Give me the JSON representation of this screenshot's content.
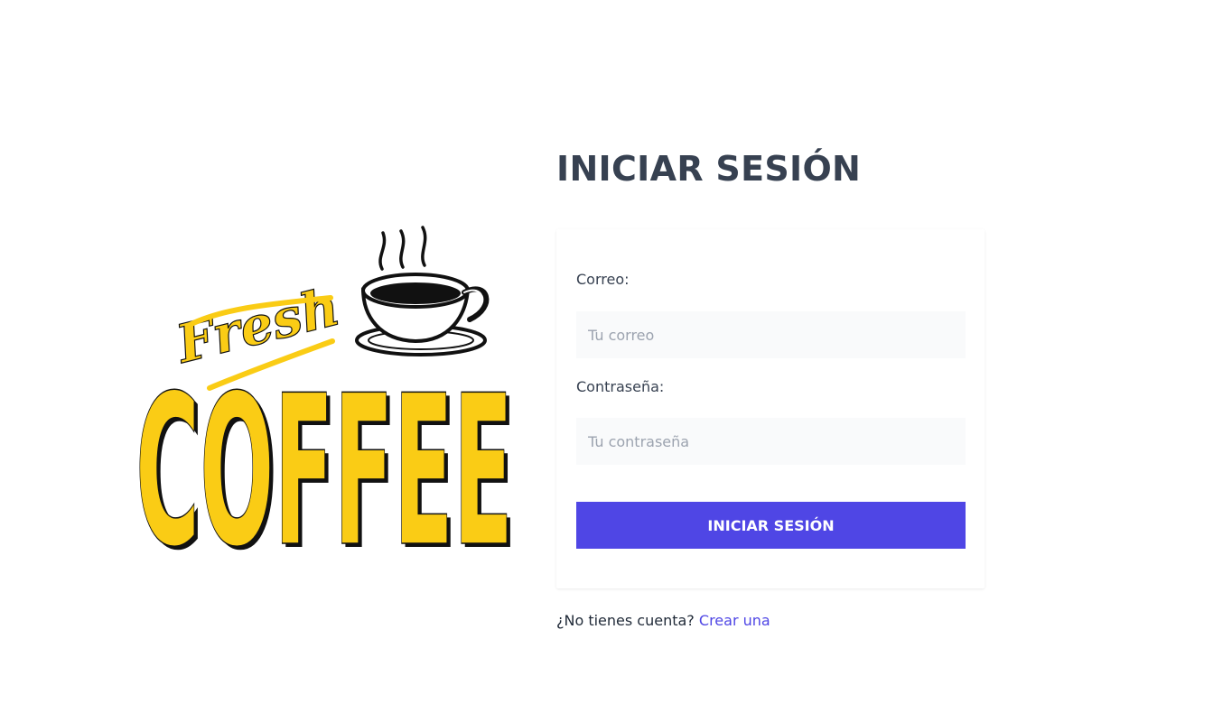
{
  "logo": {
    "script_word": "Fresh",
    "main_word": "COFFEE",
    "colors": {
      "yellow": "#facc15",
      "ink": "#111111"
    },
    "icon": "coffee-cup-icon"
  },
  "login": {
    "title": "INICIAR SESIÓN",
    "email_label": "Correo:",
    "email_placeholder": "Tu correo",
    "email_value": "",
    "password_label": "Contraseña:",
    "password_placeholder": "Tu contraseña",
    "password_value": "",
    "submit_label": "INICIAR SESIÓN"
  },
  "footer": {
    "question": "¿No tienes cuenta? ",
    "link_label": "Crear una"
  },
  "colors": {
    "accent": "#4f46e5",
    "heading": "#374151",
    "input_bg": "#f9fafb"
  }
}
